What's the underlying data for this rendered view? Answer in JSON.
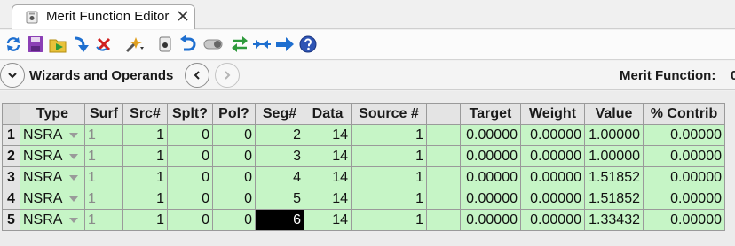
{
  "tab": {
    "title": "Merit Function Editor"
  },
  "toolbar": {
    "buttons": [
      "refresh-icon",
      "save-icon",
      "load-icon",
      "insert-icon",
      "delete-icon",
      "wizard-icon",
      "device-icon",
      "undo-icon",
      "toggle-icon",
      "swap-icon",
      "compress-icon",
      "arrow-right-icon",
      "help-icon"
    ]
  },
  "wizard_bar": {
    "label": "Wizards and Operands",
    "merit_label": "Merit Function:",
    "merit_value": "0"
  },
  "grid": {
    "columns": [
      "Type",
      "Surf",
      "Src#",
      "Splt?",
      "Pol?",
      "Seg#",
      "Data",
      "Source #",
      "",
      "Target",
      "Weight",
      "Value",
      "% Contrib"
    ],
    "rows": [
      {
        "num": "1",
        "type": "NSRA",
        "surf": "1",
        "src": "1",
        "splt": "0",
        "pol": "0",
        "seg": "2",
        "data": "14",
        "source": "1",
        "blank": "",
        "target": "0.00000",
        "weight": "0.00000",
        "value": "1.00000",
        "contrib": "0.00000"
      },
      {
        "num": "2",
        "type": "NSRA",
        "surf": "1",
        "src": "1",
        "splt": "0",
        "pol": "0",
        "seg": "3",
        "data": "14",
        "source": "1",
        "blank": "",
        "target": "0.00000",
        "weight": "0.00000",
        "value": "1.00000",
        "contrib": "0.00000"
      },
      {
        "num": "3",
        "type": "NSRA",
        "surf": "1",
        "src": "1",
        "splt": "0",
        "pol": "0",
        "seg": "4",
        "data": "14",
        "source": "1",
        "blank": "",
        "target": "0.00000",
        "weight": "0.00000",
        "value": "1.51852",
        "contrib": "0.00000"
      },
      {
        "num": "4",
        "type": "NSRA",
        "surf": "1",
        "src": "1",
        "splt": "0",
        "pol": "0",
        "seg": "5",
        "data": "14",
        "source": "1",
        "blank": "",
        "target": "0.00000",
        "weight": "0.00000",
        "value": "1.51852",
        "contrib": "0.00000"
      },
      {
        "num": "5",
        "type": "NSRA",
        "surf": "1",
        "src": "1",
        "splt": "0",
        "pol": "0",
        "seg": "6",
        "data": "14",
        "source": "1",
        "blank": "",
        "target": "0.00000",
        "weight": "0.00000",
        "value": "1.33432",
        "contrib": "0.00000"
      }
    ],
    "selected": {
      "row": 5,
      "column": "Seg#"
    },
    "row_color": "#c6f5c6",
    "header_color": "#e4e4e4"
  }
}
